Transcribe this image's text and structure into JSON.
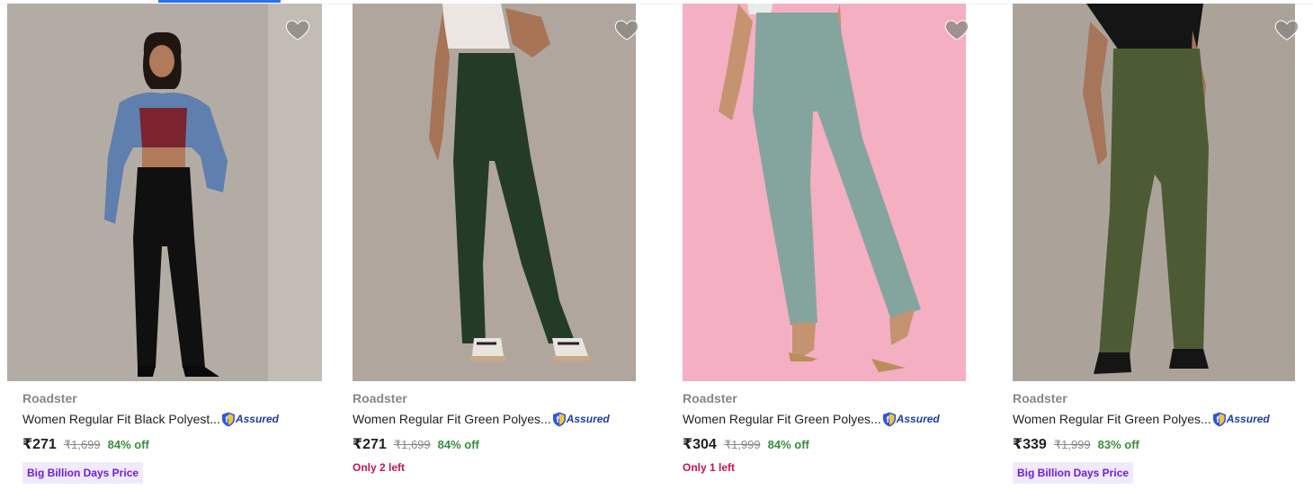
{
  "products": [
    {
      "brand": "Roadster",
      "title": "Women Regular Fit Black Polyest...",
      "assured": "Assured",
      "price": "₹271",
      "mrp": "₹1,699",
      "off": "84% off",
      "badge": "Big Billion Days Price",
      "note": ""
    },
    {
      "brand": "Roadster",
      "title": "Women Regular Fit Green Polyes...",
      "assured": "Assured",
      "price": "₹271",
      "mrp": "₹1,699",
      "off": "84% off",
      "badge": "",
      "note": "Only 2 left"
    },
    {
      "brand": "Roadster",
      "title": "Women Regular Fit Green Polyes...",
      "assured": "Assured",
      "price": "₹304",
      "mrp": "₹1,999",
      "off": "84% off",
      "badge": "",
      "note": "Only 1 left"
    },
    {
      "brand": "Roadster",
      "title": "Women Regular Fit Green Polyes...",
      "assured": "Assured",
      "price": "₹339",
      "mrp": "₹1,999",
      "off": "83% off",
      "badge": "Big Billion Days Price",
      "note": ""
    }
  ],
  "colors": {
    "accent": "#2874f0",
    "discount": "#388e3c",
    "badge_bg": "#f1eafd",
    "badge_text": "#6a1fd6",
    "stock_note": "#c7154f"
  },
  "icons": {
    "wishlist": "heart-icon",
    "assured": "flipkart-assured-icon"
  }
}
